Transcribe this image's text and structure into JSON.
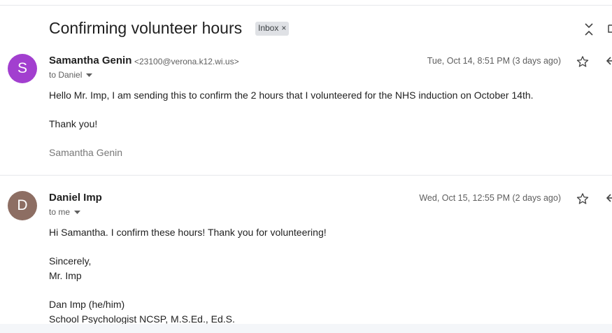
{
  "thread": {
    "subject": "Confirming volunteer hours",
    "label_chip": "Inbox",
    "label_remove": "×"
  },
  "messages": [
    {
      "avatar_letter": "S",
      "avatar_color": "#a23fcf",
      "sender_name": "Samantha Genin",
      "sender_email": "<23100@verona.k12.wi.us>",
      "recipient": "to Daniel",
      "date": "Tue, Oct 14, 8:51 PM (3 days ago)",
      "body": [
        "Hello Mr. Imp, I am sending this to confirm the 2 hours that I volunteered for the NHS induction on October 14th.",
        "Thank you!",
        "Samantha Genin"
      ]
    },
    {
      "avatar_letter": "D",
      "avatar_color": "#8d6e63",
      "sender_name": "Daniel Imp",
      "recipient": "to me",
      "date": "Wed, Oct 15, 12:55 PM (2 days ago)",
      "body": [
        "Hi Samantha. I confirm these hours! Thank you for volunteering!",
        "Sincerely,",
        "Mr. Imp",
        "Dan Imp (he/him)",
        "School Psychologist NCSP, M.S.Ed., Ed.S."
      ]
    }
  ],
  "icons": {
    "collapse": "collapse-all-icon",
    "print": "print-icon",
    "star": "star-icon",
    "reply": "reply-icon",
    "dropdown": "caret-down-icon"
  }
}
